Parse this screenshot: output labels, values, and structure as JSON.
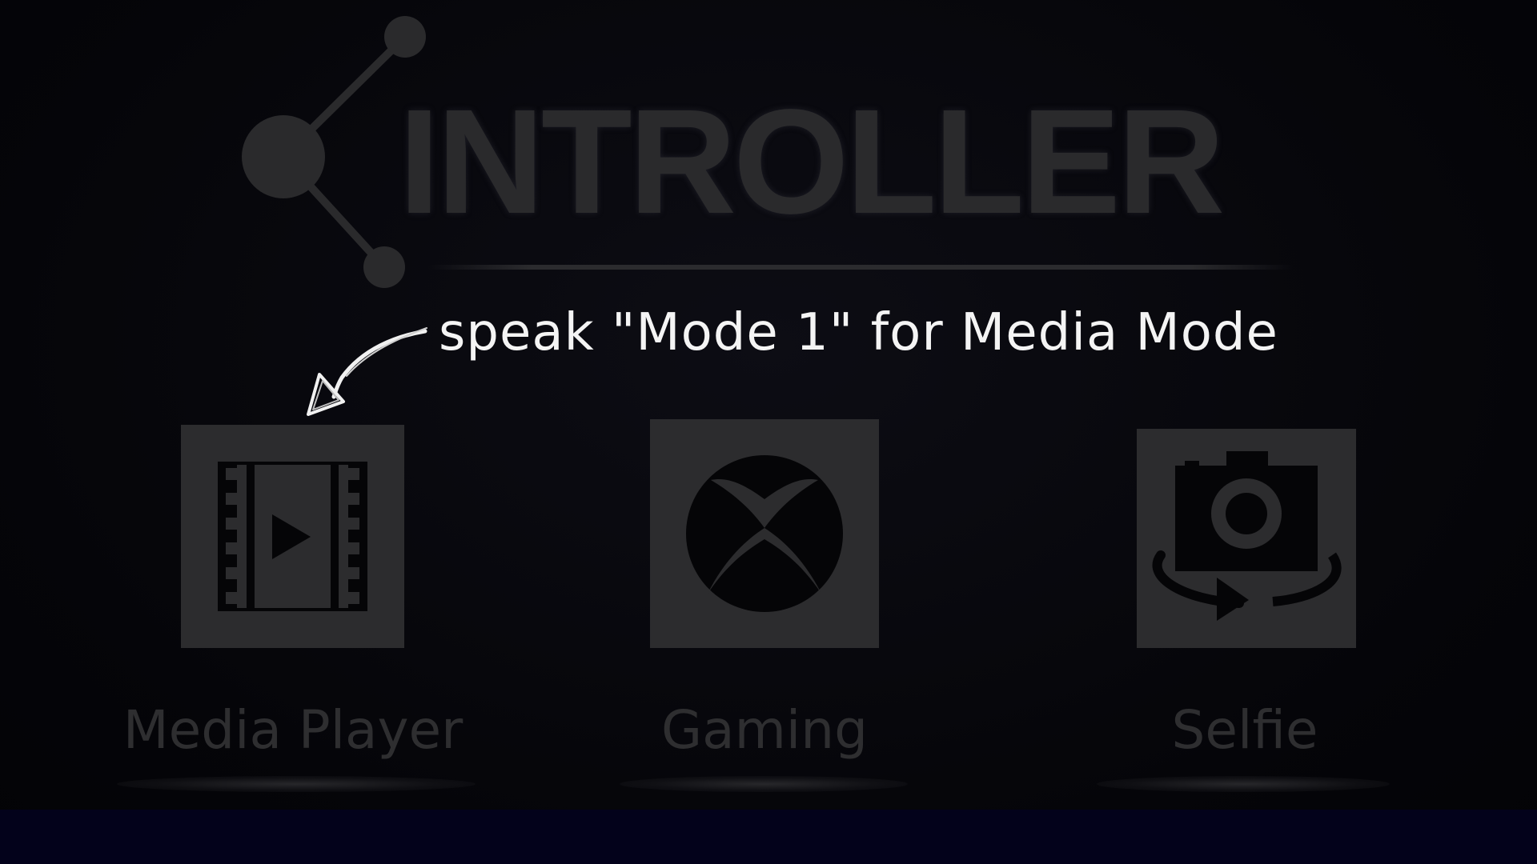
{
  "app": {
    "logo_text": "INTROLLER"
  },
  "hint": {
    "text": "speak \"Mode 1\" for Media Mode"
  },
  "modes": [
    {
      "label": "Media Player",
      "icon": "film-play-icon"
    },
    {
      "label": "Gaming",
      "icon": "xbox-icon"
    },
    {
      "label": "Selfie",
      "icon": "camera-rotate-icon"
    }
  ],
  "colors": {
    "background": "#050509",
    "bottom_bar": "#03021b",
    "tile": "#2c2c2e",
    "label": "#2e2e30",
    "hint_text": "#f4f4f4"
  }
}
